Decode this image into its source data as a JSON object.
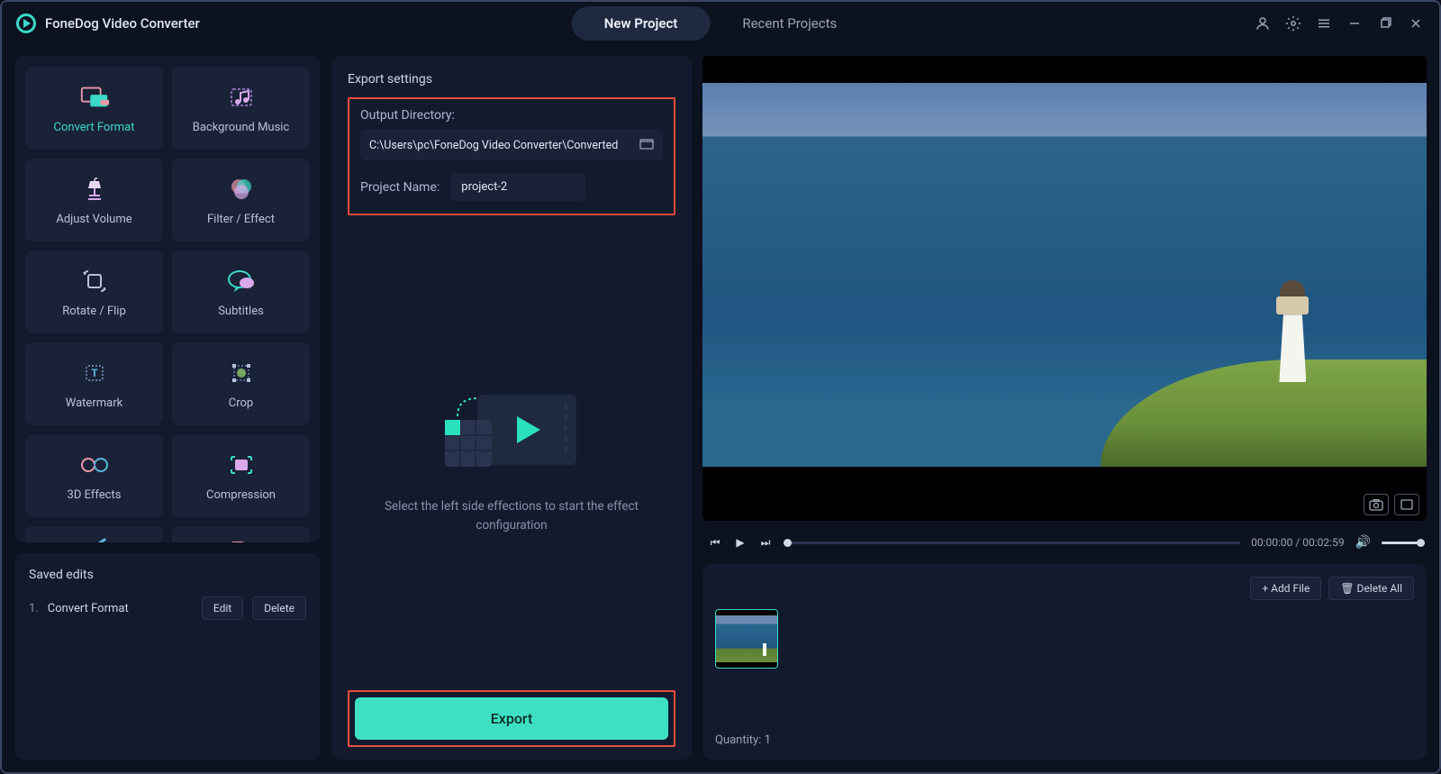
{
  "app": {
    "title": "FoneDog Video Converter"
  },
  "tabs": {
    "new_project": "New Project",
    "recent_projects": "Recent Projects"
  },
  "tools": [
    {
      "id": "convert-format",
      "label": "Convert Format",
      "active": true
    },
    {
      "id": "background-music",
      "label": "Background Music"
    },
    {
      "id": "adjust-volume",
      "label": "Adjust Volume"
    },
    {
      "id": "filter-effect",
      "label": "Filter / Effect"
    },
    {
      "id": "rotate-flip",
      "label": "Rotate / Flip"
    },
    {
      "id": "subtitles",
      "label": "Subtitles"
    },
    {
      "id": "watermark",
      "label": "Watermark"
    },
    {
      "id": "crop",
      "label": "Crop"
    },
    {
      "id": "3d-effects",
      "label": "3D Effects"
    },
    {
      "id": "compression",
      "label": "Compression"
    }
  ],
  "saved": {
    "title": "Saved edits",
    "items": [
      {
        "num": "1.",
        "name": "Convert Format"
      }
    ],
    "edit": "Edit",
    "delete": "Delete"
  },
  "export": {
    "title": "Export settings",
    "output_dir_label": "Output Directory:",
    "output_dir_value": "C:\\Users\\pc\\FoneDog Video Converter\\Converted",
    "project_name_label": "Project Name:",
    "project_name_value": "project-2",
    "instruction": "Select the left side effections to start the effect configuration",
    "button": "Export"
  },
  "player": {
    "current": "00:00:00",
    "total": "00:02:59"
  },
  "files": {
    "add_file": "Add File",
    "delete_all": "Delete All",
    "quantity_label": "Quantity:",
    "quantity_value": "1"
  }
}
